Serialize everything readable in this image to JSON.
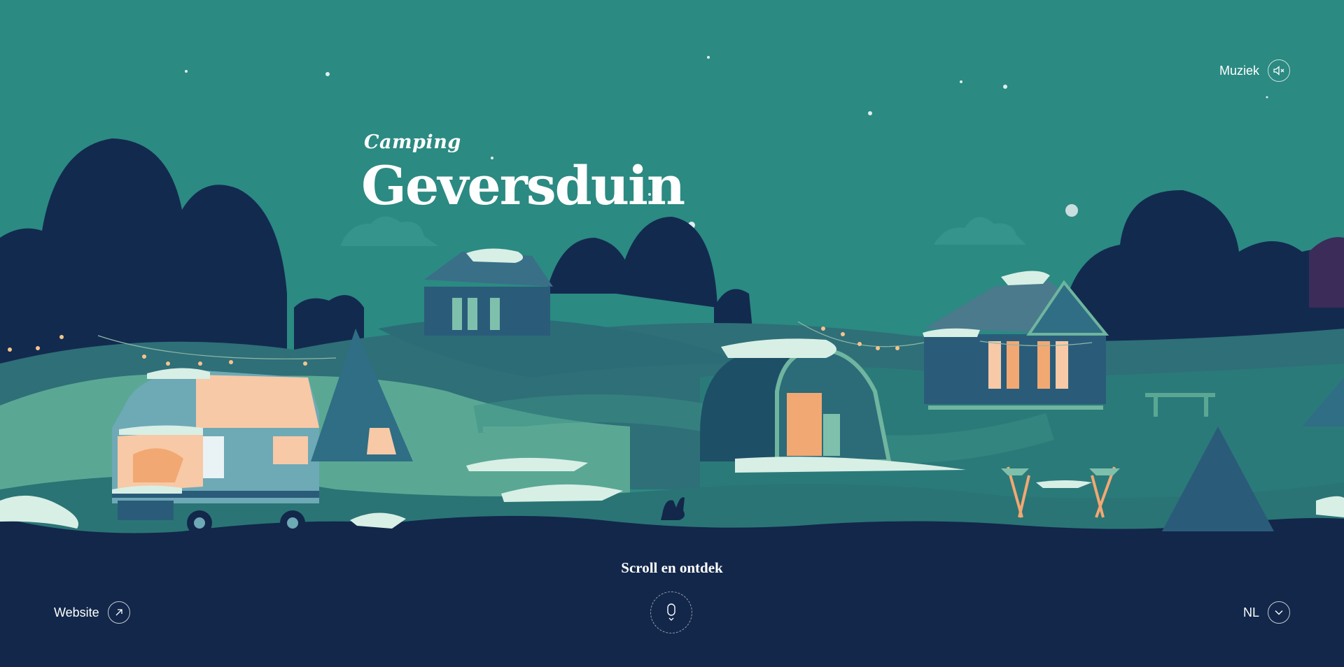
{
  "header": {
    "music_label": "Muziek",
    "music_icon": "speaker-muted-icon"
  },
  "logo": {
    "subtitle": "Camping",
    "title": "Geversduin"
  },
  "footer": {
    "scroll_label": "Scroll en ontdek",
    "scroll_icon": "mouse-icon",
    "website_label": "Website",
    "website_icon": "arrow-up-right-icon",
    "language": "NL",
    "language_icon": "chevron-down-icon"
  },
  "colors": {
    "sky": "#2b8a82",
    "dark_trees": "#132a4f",
    "hill_light": "#5aa894",
    "hill_mid": "#2f7e78",
    "hill_dark": "#1f5f6a",
    "ground_footer": "#12274a",
    "snow": "#d8efe6",
    "peach": "#f7c9a6",
    "warm_light": "#f2a872"
  }
}
